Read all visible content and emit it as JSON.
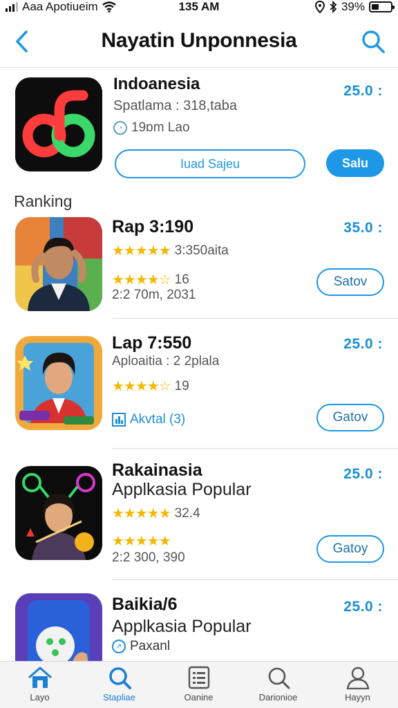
{
  "status_bar": {
    "carrier": "Aaa Apotiueim",
    "time": "135 AM",
    "battery": "39%",
    "battery_level": 0.39
  },
  "nav": {
    "title": "Nayatin Unponnesia"
  },
  "featured": {
    "name": "Indoanesia",
    "subtitle": "Spatlama : 318,taba",
    "meta": "19ɒm Lao",
    "price": "25.0 :",
    "primary_button": "Iuad Sajeu",
    "secondary_button": "Salu"
  },
  "section": {
    "title": "Ranking"
  },
  "rankings": [
    {
      "name": "Rap 3:190",
      "line1": "3:350aita",
      "line1_stars": "★★★★★",
      "line2": "16",
      "line2_stars": "★★★★☆",
      "line3": "2:2 70m, 2031",
      "price": "35.0 :",
      "button": "Satov"
    },
    {
      "name": "Lap 7:550",
      "line1": "Aploaitia : 2 2plala",
      "line2": "19",
      "line2_stars": "★★★★☆",
      "line3": "Akvtal (3)",
      "price": "25.0 :",
      "button": "Gatov"
    },
    {
      "name": "Rakainasia",
      "line1": "Applkasia Popular",
      "line2": "32.4",
      "line2_stars": "★★★★★",
      "line3_stars": "★★★★★",
      "line4": "2:2 300, 390",
      "price": "25.0 :",
      "button": "Gatoy"
    },
    {
      "name": "Baikia/6",
      "line1": "Applkasia Popular",
      "line2": "Paxanl",
      "price": "25.0 :"
    }
  ],
  "tab_bar": {
    "tabs": [
      {
        "label": "Layo",
        "icon": "home-icon"
      },
      {
        "label": "Stapliae",
        "icon": "search-icon"
      },
      {
        "label": "Oanine",
        "icon": "list-icon"
      },
      {
        "label": "Darionioe",
        "icon": "search-icon"
      },
      {
        "label": "Hayyn",
        "icon": "person-icon"
      }
    ],
    "active_index": 1
  },
  "colors": {
    "accent": "#1d97e6",
    "price": "#1a8fd6",
    "star": "#f5b800"
  }
}
